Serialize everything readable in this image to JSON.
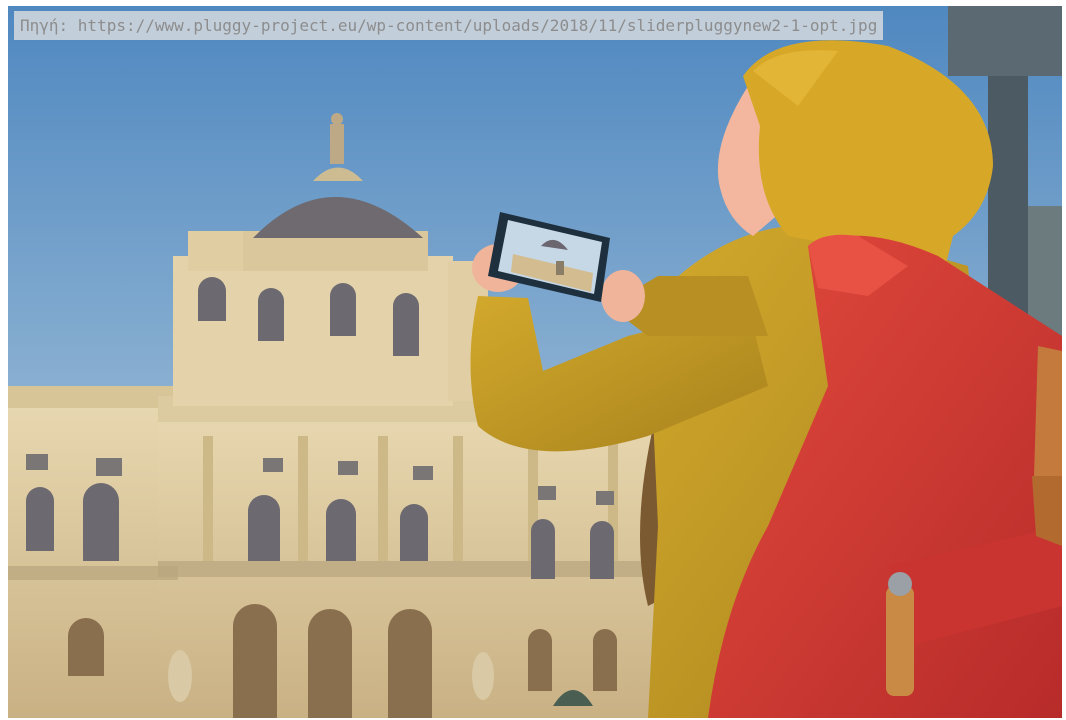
{
  "caption": {
    "text": "Πηγή: https://www.pluggy-project.eu/wp-content/uploads/2018/11/sliderpluggynew2-1-opt.jpg"
  },
  "photo": {
    "palette": {
      "sky_top": "#4f88c0",
      "sky_bottom": "#bcd1e0",
      "building": "#e2cfa3",
      "building_shadow": "#b9a57e",
      "dome": "#6e6a6f",
      "jacket": "#c99f25",
      "hood": "#d7a827",
      "backpack": "#d83a33",
      "strap": "#c47a3c"
    }
  }
}
